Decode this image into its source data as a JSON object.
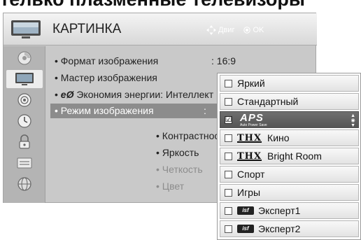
{
  "page_heading": "телько плазменные телевизоры",
  "header": {
    "title": "КАРТИНКА",
    "move_hint": "Двиг",
    "ok_hint": "OK",
    "icon": "tv-icon"
  },
  "sidebar": {
    "items": [
      {
        "icon": "disc-icon",
        "active": false
      },
      {
        "icon": "tv-screen-icon",
        "active": true
      },
      {
        "icon": "speaker-icon",
        "active": false
      },
      {
        "icon": "clock-icon",
        "active": false
      },
      {
        "icon": "lock-icon",
        "active": false
      },
      {
        "icon": "options-icon",
        "active": false
      },
      {
        "icon": "globe-icon",
        "active": false
      }
    ]
  },
  "menu": {
    "aspect_label": "• Формат изображения",
    "aspect_value": ": 16:9",
    "wizard_label": "• Мастер изображения",
    "energy_prefix": "• ",
    "energy_glyph": "eØ",
    "energy_label": " Экономия энергии: Интеллект",
    "mode_label": "• Режим изображения",
    "mode_colon": ":",
    "contrast_label": "• Контрастност",
    "brightness_label": "• Яркость",
    "sharpness_label": "• Четкость",
    "color_label": "• Цвет"
  },
  "dropdown": {
    "items": [
      {
        "label": "Яркий",
        "checked": false,
        "logo": ""
      },
      {
        "label": "Стандартный",
        "checked": false,
        "logo": ""
      },
      {
        "label": "",
        "checked": true,
        "logo": "APS",
        "logo_sub": "Auto Power Save",
        "check_mark": "☑"
      },
      {
        "label": "Кино",
        "checked": false,
        "logo": "THX"
      },
      {
        "label": "Bright Room",
        "checked": false,
        "logo": "THX"
      },
      {
        "label": "Спорт",
        "checked": false,
        "logo": ""
      },
      {
        "label": "Игры",
        "checked": false,
        "logo": ""
      },
      {
        "label": "Эксперт1",
        "checked": false,
        "logo": "isf"
      },
      {
        "label": "Эксперт2",
        "checked": false,
        "logo": "isf"
      }
    ]
  },
  "colors": {
    "osd_background": "#c9c9c9",
    "highlight": "#8c8c8c",
    "selected_item": "#5f5f5f"
  }
}
